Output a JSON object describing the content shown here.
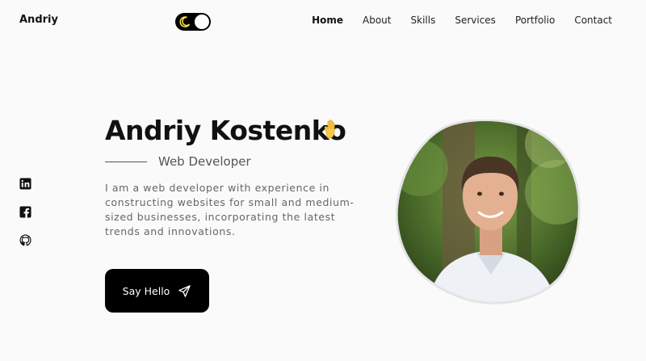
{
  "header": {
    "logo": "Andriy",
    "theme_toggle": {
      "icon": "moon-icon",
      "state": "dark-off"
    },
    "nav": [
      {
        "label": "Home",
        "active": true
      },
      {
        "label": "About"
      },
      {
        "label": "Skills"
      },
      {
        "label": "Services"
      },
      {
        "label": "Portfolio"
      },
      {
        "label": "Contact"
      }
    ]
  },
  "socials": [
    {
      "icon": "linkedin-icon"
    },
    {
      "icon": "facebook-icon"
    },
    {
      "icon": "github-icon"
    }
  ],
  "hero": {
    "name": "Andriy Kostenko",
    "emoji": "waving-hand-icon",
    "subtitle": "Web Developer",
    "description": "I am a web developer with experience in constructing websites for small and medium-sized businesses, incorporating the latest trends and innovations.",
    "cta_label": "Say Hello",
    "cta_icon": "send-icon"
  },
  "colors": {
    "background": "#fafafa",
    "primary": "#000000",
    "accent": "#f5c542",
    "text_muted": "#666666"
  }
}
